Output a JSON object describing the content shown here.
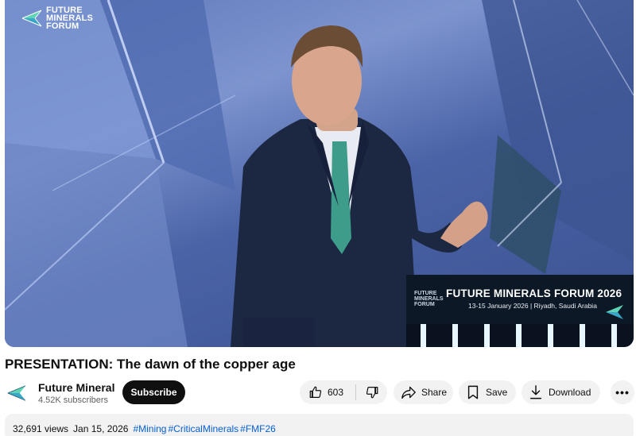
{
  "player": {
    "watermark_lines": [
      "FUTURE",
      "MINERALS",
      "FORUM"
    ],
    "screen_small_logo_lines": [
      "FUTURE",
      "MINERALS",
      "FORUM"
    ],
    "screen_title": "FUTURE MINERALS FORUM 2026",
    "screen_subtitle": "13-15 January 2026 | Riyadh, Saudi Arabia"
  },
  "video": {
    "title": "PRESENTATION: The dawn of the copper age"
  },
  "channel": {
    "name": "Future Mineral",
    "subscribers": "4.52K subscribers",
    "subscribe_label": "Subscribe",
    "avatar_icon": "fmf-logo-icon"
  },
  "actions": {
    "like_count": "603",
    "like_icon": "thumbs-up-icon",
    "dislike_icon": "thumbs-down-icon",
    "share_label": "Share",
    "share_icon": "share-arrow-icon",
    "save_label": "Save",
    "save_icon": "bookmark-icon",
    "download_label": "Download",
    "download_icon": "download-icon",
    "more_label": "•••"
  },
  "description": {
    "views": "32,691 views",
    "date": "Jan 15, 2026",
    "hashtags": [
      "#Mining",
      "#CriticalMinerals",
      "#FMF26"
    ]
  },
  "colors": {
    "hashtag": "#065fd4",
    "subscribe_bg": "#0f0f0f",
    "pill_bg": "#f2f2f2",
    "stage_bg": "#4a63a6"
  }
}
